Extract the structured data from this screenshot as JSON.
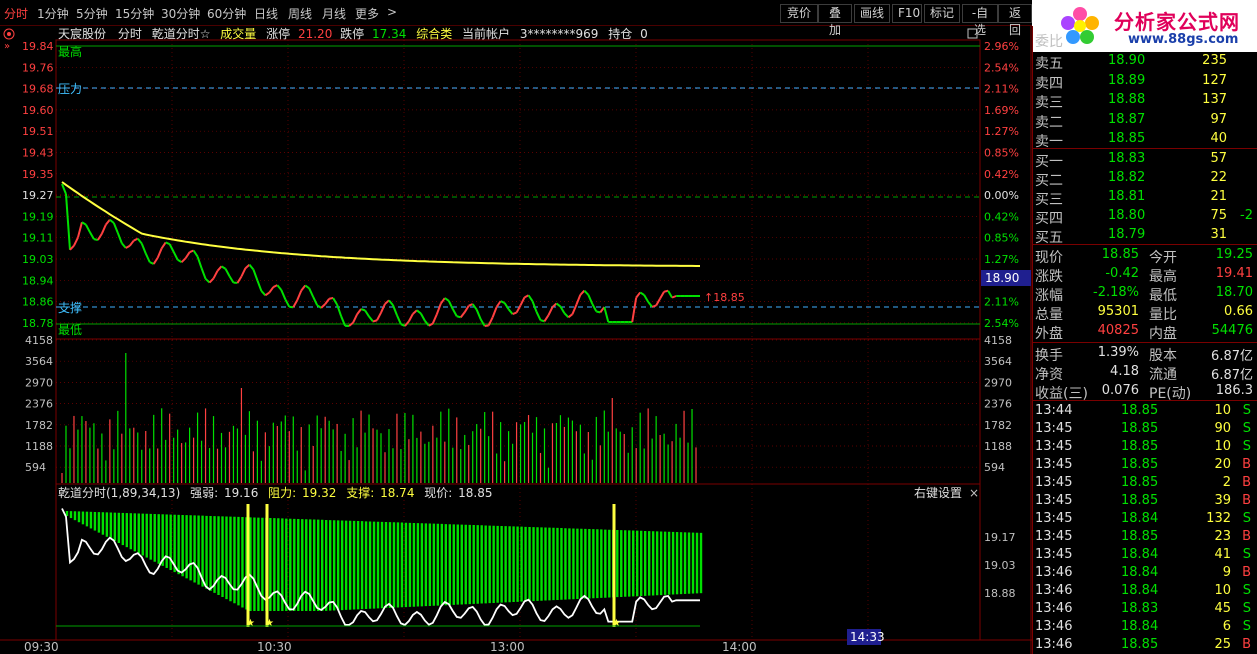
{
  "toolbar": {
    "periods": [
      "分时",
      "1分钟",
      "5分钟",
      "15分钟",
      "30分钟",
      "60分钟",
      "日线",
      "周线",
      "月线",
      "更多"
    ],
    "more_arrow": ">",
    "right_buttons": [
      "竞价",
      "叠加",
      "画线",
      "F10",
      "标记",
      "-自选",
      "返回"
    ]
  },
  "logo": {
    "title": "分析家公式网",
    "url": "www.88gs.com"
  },
  "header": {
    "stock_name": "天宸股份",
    "mode": "分时",
    "indicator": "乾道分时☆",
    "volume_label": "成交量",
    "limit_up_label": "涨停",
    "limit_up": "21.20",
    "limit_down_label": "跌停",
    "limit_down": "17.34",
    "category": "综合类",
    "account_label": "当前帐户",
    "account": "3********969",
    "position_label": "持仓",
    "position": "0"
  },
  "price_axis": {
    "left": [
      "19.84",
      "19.76",
      "19.68",
      "19.60",
      "19.51",
      "19.43",
      "19.35",
      "19.27",
      "19.19",
      "19.11",
      "19.03",
      "18.94",
      "18.86",
      "18.78"
    ],
    "right": [
      "2.96%",
      "2.54%",
      "2.11%",
      "1.69%",
      "1.27%",
      "0.85%",
      "0.42%",
      "0.00%",
      "0.42%",
      "0.85%",
      "1.27%",
      "1.69%",
      "2.11%",
      "2.54%"
    ],
    "current_price_tag": "18.90",
    "price_marker": "↑18.85"
  },
  "annotations": {
    "high": "最高",
    "pressure": "压力",
    "support": "支撑",
    "low": "最低"
  },
  "volume_axis": [
    "4158",
    "3564",
    "2970",
    "2376",
    "1782",
    "1188",
    "594"
  ],
  "indicator_panel": {
    "title": "乾道分时(1,89,34,13)",
    "strength_label": "强弱:",
    "strength": "19.16",
    "resist_label": "阻力:",
    "resist": "19.32",
    "support_label": "支撑:",
    "support": "18.74",
    "price_label": "现价:",
    "price": "18.85",
    "settings": "右键设置",
    "close": "×",
    "axis": [
      "19.17",
      "19.03",
      "18.88"
    ]
  },
  "time_axis": [
    "09:30",
    "10:30",
    "13:00",
    "14:00"
  ],
  "cursor_time": "14:33",
  "quote": {
    "sell_label": "委比",
    "asks": [
      {
        "label": "卖五",
        "price": "18.90",
        "vol": "235"
      },
      {
        "label": "卖四",
        "price": "18.89",
        "vol": "127"
      },
      {
        "label": "卖三",
        "price": "18.88",
        "vol": "137"
      },
      {
        "label": "卖二",
        "price": "18.87",
        "vol": "97"
      },
      {
        "label": "卖一",
        "price": "18.85",
        "vol": "40"
      }
    ],
    "bids": [
      {
        "label": "买一",
        "price": "18.83",
        "vol": "57",
        "extra": ""
      },
      {
        "label": "买二",
        "price": "18.82",
        "vol": "22",
        "extra": ""
      },
      {
        "label": "买三",
        "price": "18.81",
        "vol": "21",
        "extra": ""
      },
      {
        "label": "买四",
        "price": "18.80",
        "vol": "75",
        "extra": "-2"
      },
      {
        "label": "买五",
        "price": "18.79",
        "vol": "31",
        "extra": ""
      }
    ],
    "stats": [
      {
        "l1": "现价",
        "v1": "18.85",
        "c1": "g",
        "l2": "今开",
        "v2": "19.25",
        "c2": "g"
      },
      {
        "l1": "涨跌",
        "v1": "-0.42",
        "c1": "g",
        "l2": "最高",
        "v2": "19.41",
        "c2": "r"
      },
      {
        "l1": "涨幅",
        "v1": "-2.18%",
        "c1": "g",
        "l2": "最低",
        "v2": "18.70",
        "c2": "g"
      },
      {
        "l1": "总量",
        "v1": "95301",
        "c1": "y",
        "l2": "量比",
        "v2": "0.66",
        "c2": "y"
      },
      {
        "l1": "外盘",
        "v1": "40825",
        "c1": "r",
        "l2": "内盘",
        "v2": "54476",
        "c2": "g"
      }
    ],
    "fin": [
      {
        "l1": "换手",
        "v1": "1.39%",
        "l2": "股本",
        "v2": "6.87亿"
      },
      {
        "l1": "净资",
        "v1": "4.18",
        "l2": "流通",
        "v2": "6.87亿"
      },
      {
        "l1": "收益(三)",
        "v1": "0.076",
        "l2": "PE(动)",
        "v2": "186.3"
      }
    ],
    "ticks": [
      {
        "t": "13:44",
        "p": "18.85",
        "v": "10",
        "s": "S"
      },
      {
        "t": "13:45",
        "p": "18.85",
        "v": "90",
        "s": "S"
      },
      {
        "t": "13:45",
        "p": "18.85",
        "v": "10",
        "s": "S"
      },
      {
        "t": "13:45",
        "p": "18.85",
        "v": "20",
        "s": "B"
      },
      {
        "t": "13:45",
        "p": "18.85",
        "v": "2",
        "s": "B"
      },
      {
        "t": "13:45",
        "p": "18.85",
        "v": "39",
        "s": "B"
      },
      {
        "t": "13:45",
        "p": "18.84",
        "v": "132",
        "s": "S"
      },
      {
        "t": "13:45",
        "p": "18.85",
        "v": "23",
        "s": "B"
      },
      {
        "t": "13:45",
        "p": "18.84",
        "v": "41",
        "s": "S"
      },
      {
        "t": "13:46",
        "p": "18.84",
        "v": "9",
        "s": "B"
      },
      {
        "t": "13:46",
        "p": "18.84",
        "v": "10",
        "s": "S"
      },
      {
        "t": "13:46",
        "p": "18.83",
        "v": "45",
        "s": "S"
      },
      {
        "t": "13:46",
        "p": "18.84",
        "v": "6",
        "s": "S"
      },
      {
        "t": "13:46",
        "p": "18.85",
        "v": "25",
        "s": "B"
      }
    ]
  },
  "colors": {
    "up": "#ff4040",
    "down": "#00e000",
    "avg": "#ffff40",
    "grid": "#7a0000",
    "support": "#40b0ff"
  }
}
